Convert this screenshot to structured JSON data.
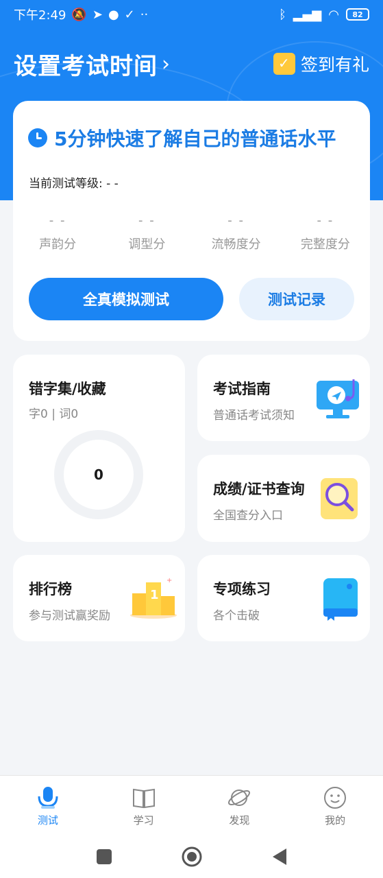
{
  "status_bar": {
    "time": "下午2:49",
    "battery": "82"
  },
  "header": {
    "title": "设置考试时间",
    "checkin_label": "签到有礼"
  },
  "test_card": {
    "title": "5分钟快速了解自己的普通话水平",
    "level_text": "当前测试等级: - -",
    "scores": [
      {
        "value": "- -",
        "label": "声韵分"
      },
      {
        "value": "- -",
        "label": "调型分"
      },
      {
        "value": "- -",
        "label": "流畅度分"
      },
      {
        "value": "- -",
        "label": "完整度分"
      }
    ],
    "primary_button": "全真模拟测试",
    "secondary_button": "测试记录"
  },
  "tiles": {
    "mistakes": {
      "title": "错字集/收藏",
      "subtitle": "字0 | 词0",
      "count": "0"
    },
    "guide": {
      "title": "考试指南",
      "subtitle": "普通话考试须知"
    },
    "score_query": {
      "title": "成绩/证书查询",
      "subtitle": "全国查分入口"
    },
    "ranking": {
      "title": "排行榜",
      "subtitle": "参与测试赢奖励"
    },
    "practice": {
      "title": "专项练习",
      "subtitle": "各个击破"
    }
  },
  "tabbar": [
    {
      "label": "测试",
      "icon": "microphone-icon",
      "active": true
    },
    {
      "label": "学习",
      "icon": "book-icon",
      "active": false
    },
    {
      "label": "发现",
      "icon": "planet-icon",
      "active": false
    },
    {
      "label": "我的",
      "icon": "smiley-icon",
      "active": false
    }
  ],
  "colors": {
    "brand": "#1b85f4",
    "background": "#f3f5f8"
  }
}
